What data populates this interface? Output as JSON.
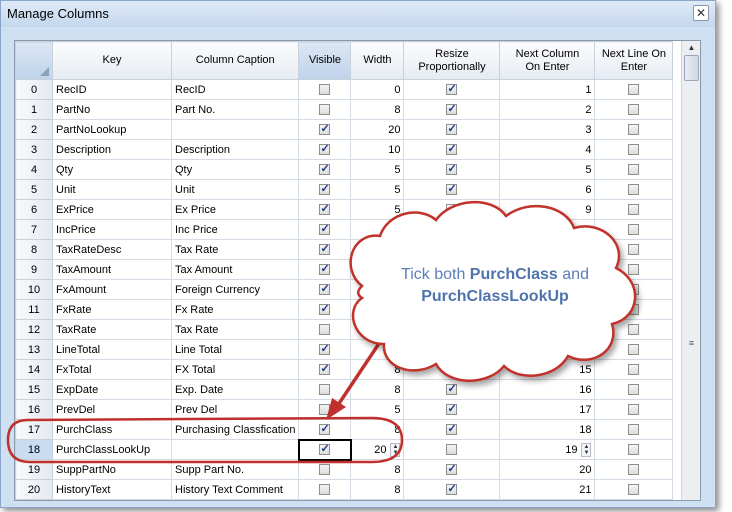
{
  "window": {
    "title": "Manage Columns",
    "close_icon": "close-icon"
  },
  "columns": [
    "Key",
    "Column Caption",
    "Visible",
    "Width",
    "Resize\nProportionally",
    "Next Column\nOn Enter",
    "Next Line On\nEnter"
  ],
  "rows": [
    {
      "num": "0",
      "key": "RecID",
      "caption": "RecID",
      "visible": false,
      "width": "0",
      "resize": true,
      "next_col": "1",
      "next_line": false
    },
    {
      "num": "1",
      "key": "PartNo",
      "caption": "Part No.",
      "visible": false,
      "width": "8",
      "resize": true,
      "next_col": "2",
      "next_line": false
    },
    {
      "num": "2",
      "key": "PartNoLookup",
      "caption": "",
      "visible": true,
      "width": "20",
      "resize": true,
      "next_col": "3",
      "next_line": false
    },
    {
      "num": "3",
      "key": "Description",
      "caption": "Description",
      "visible": true,
      "width": "10",
      "resize": true,
      "next_col": "4",
      "next_line": false
    },
    {
      "num": "4",
      "key": "Qty",
      "caption": "Qty",
      "visible": true,
      "width": "5",
      "resize": true,
      "next_col": "5",
      "next_line": false
    },
    {
      "num": "5",
      "key": "Unit",
      "caption": "Unit",
      "visible": true,
      "width": "5",
      "resize": true,
      "next_col": "6",
      "next_line": false
    },
    {
      "num": "6",
      "key": "ExPrice",
      "caption": "Ex Price",
      "visible": true,
      "width": "5",
      "resize": true,
      "next_col": "9",
      "next_line": false
    },
    {
      "num": "7",
      "key": "IncPrice",
      "caption": "Inc Price",
      "visible": true,
      "width": "5",
      "resize": true,
      "next_col": "",
      "next_line": false
    },
    {
      "num": "8",
      "key": "TaxRateDesc",
      "caption": "Tax Rate",
      "visible": true,
      "width": "",
      "resize": false,
      "next_col": "",
      "next_line": false
    },
    {
      "num": "9",
      "key": "TaxAmount",
      "caption": "Tax Amount",
      "visible": true,
      "width": "",
      "resize": false,
      "next_col": "",
      "next_line": false
    },
    {
      "num": "10",
      "key": "FxAmount",
      "caption": "Foreign Currency",
      "visible": true,
      "width": "",
      "resize": false,
      "next_col": "",
      "next_line": false
    },
    {
      "num": "11",
      "key": "FxRate",
      "caption": "Fx Rate",
      "visible": true,
      "width": "",
      "resize": false,
      "next_col": "",
      "next_line": false
    },
    {
      "num": "12",
      "key": "TaxRate",
      "caption": "Tax Rate",
      "visible": false,
      "width": "",
      "resize": false,
      "next_col": "",
      "next_line": false
    },
    {
      "num": "13",
      "key": "LineTotal",
      "caption": "Line Total",
      "visible": true,
      "width": "",
      "resize": true,
      "next_col": "",
      "next_line": false
    },
    {
      "num": "14",
      "key": "FxTotal",
      "caption": "FX Total",
      "visible": true,
      "width": "8",
      "resize": true,
      "next_col": "15",
      "next_line": false
    },
    {
      "num": "15",
      "key": "ExpDate",
      "caption": "Exp. Date",
      "visible": false,
      "width": "8",
      "resize": true,
      "next_col": "16",
      "next_line": false
    },
    {
      "num": "16",
      "key": "PrevDel",
      "caption": "Prev Del",
      "visible": false,
      "width": "5",
      "resize": true,
      "next_col": "17",
      "next_line": false
    },
    {
      "num": "17",
      "key": "PurchClass",
      "caption": "Purchasing Classfication",
      "visible": true,
      "width": "8",
      "resize": true,
      "next_col": "18",
      "next_line": false
    },
    {
      "num": "18",
      "key": "PurchClassLookUp",
      "caption": "",
      "visible": true,
      "width": "20",
      "resize": false,
      "next_col": "19",
      "next_line": false
    },
    {
      "num": "19",
      "key": "SuppPartNo",
      "caption": "Supp Part No.",
      "visible": false,
      "width": "8",
      "resize": true,
      "next_col": "20",
      "next_line": false
    },
    {
      "num": "20",
      "key": "HistoryText",
      "caption": "History Text Comment",
      "visible": false,
      "width": "8",
      "resize": true,
      "next_col": "21",
      "next_line": false
    }
  ],
  "callout": {
    "pre": "Tick both ",
    "b1": "PurchClass",
    "mid": " and",
    "b2": "PurchClassLookUp"
  },
  "colors": {
    "callout_fill": "#ffffff",
    "callout_stroke": "#c0302c",
    "accent": "#c9ddf2"
  }
}
